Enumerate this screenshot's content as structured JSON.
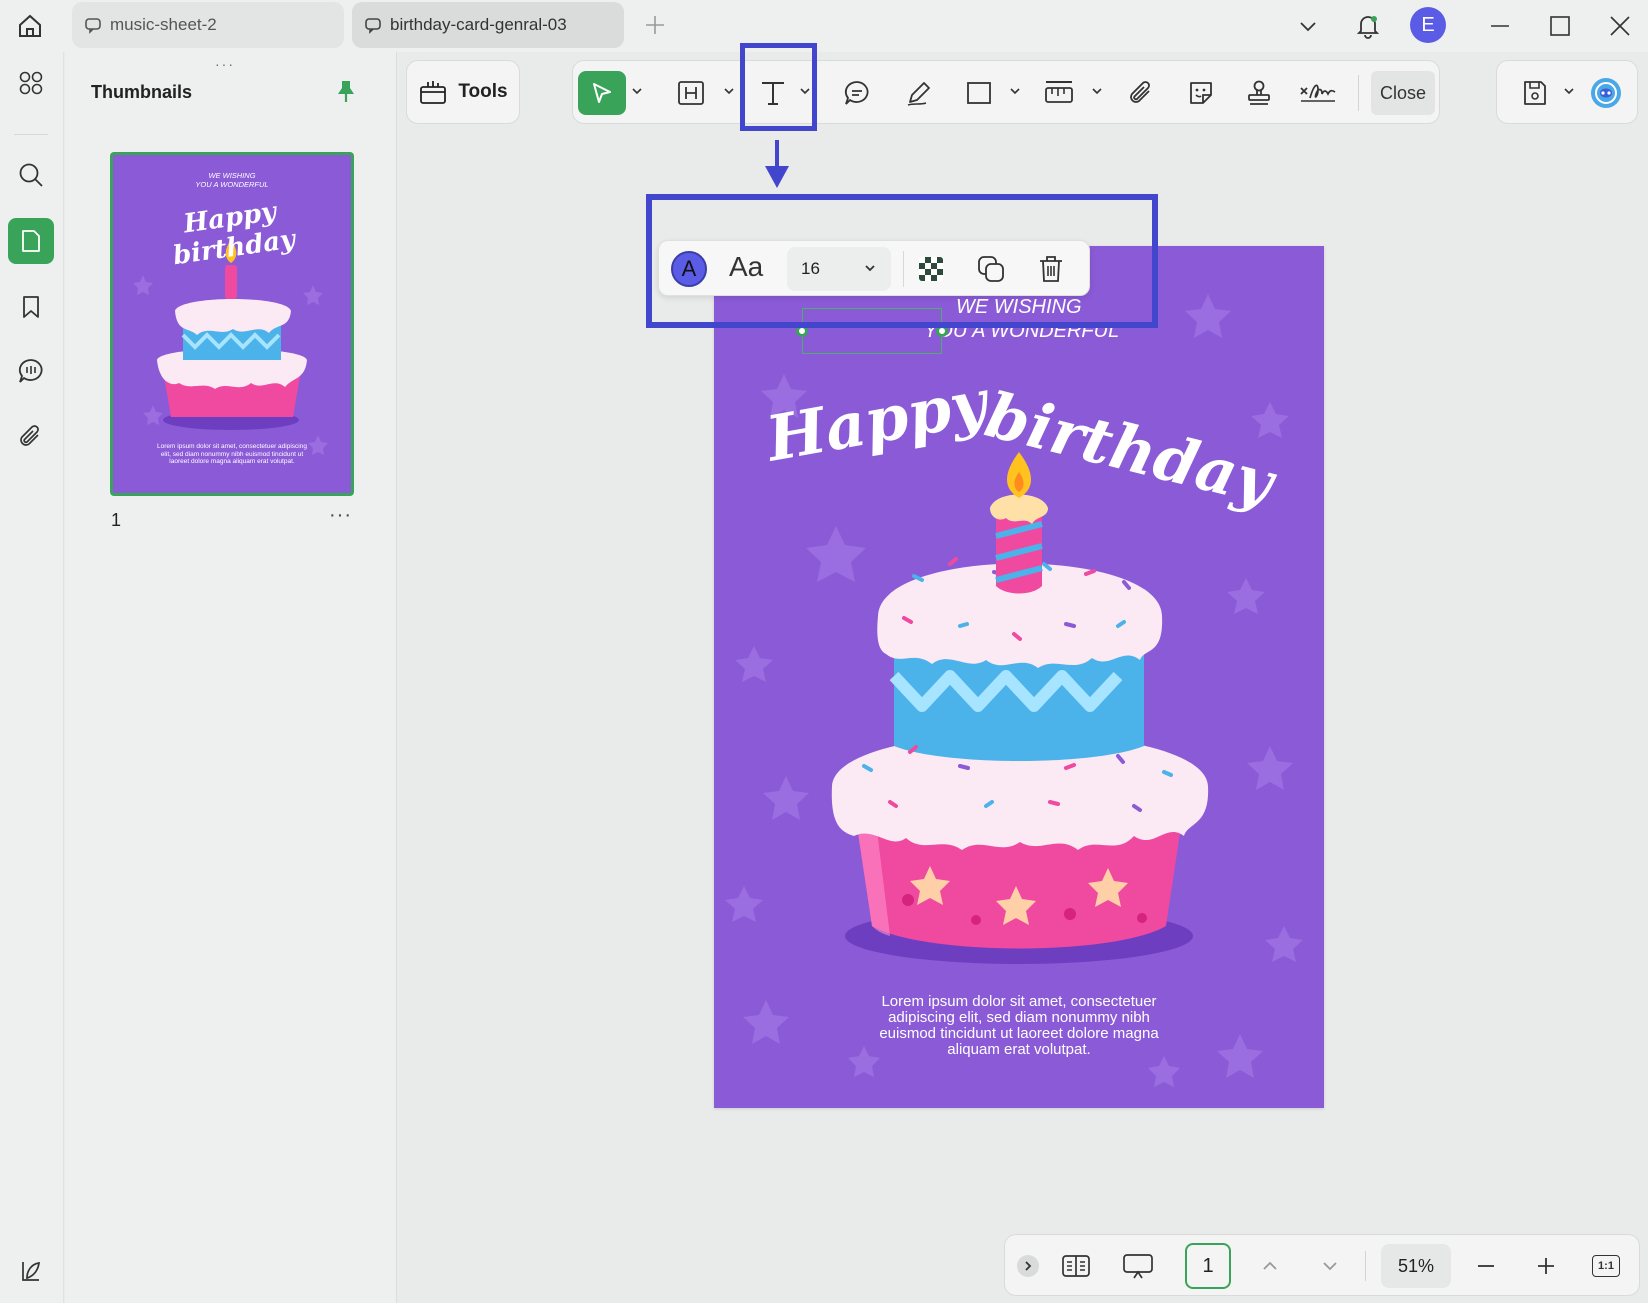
{
  "tabs": [
    {
      "label": "music-sheet-2",
      "active": false
    },
    {
      "label": "birthday-card-genral-03",
      "active": true
    }
  ],
  "user": {
    "avatar_initial": "E",
    "avatar_color": "#5b5ce6"
  },
  "thumbnails_panel": {
    "title": "Thumbnails",
    "page_number": "1",
    "more": "···"
  },
  "toolbar": {
    "tools_label": "Tools",
    "close_label": "Close",
    "accent": "#3aa35a"
  },
  "text_toolbar": {
    "color_glyph": "A",
    "font_glyph": "Aa",
    "font_size": "16",
    "text_color": "#5b5ce6"
  },
  "annotation_color": "#4246cc",
  "document": {
    "wish_line1": "WE WISHING",
    "wish_line2": "YOU A WONDERFUL",
    "headline_word1": "Happy",
    "headline_word2": "birthday",
    "lorem": "Lorem ipsum dolor sit amet, consectetuer adipiscing elit, sed diam nonummy nibh euismod tincidunt ut laoreet dolore magna aliquam erat volutpat.",
    "background": "#8b5ad7"
  },
  "thumbnail_preview": {
    "wish_line1": "WE WISHING",
    "wish_line2": "YOU A WONDERFUL",
    "headline": "Happy birthday",
    "lorem": "Lorem ipsum dolor sit amet, consectetuer adipiscing elit, sed diam nonummy nibh euismod tincidunt ut laoreet dolore magna aliquam erat volutpat."
  },
  "statusbar": {
    "page_value": "1",
    "zoom": "51%",
    "fit_label": "1:1"
  }
}
